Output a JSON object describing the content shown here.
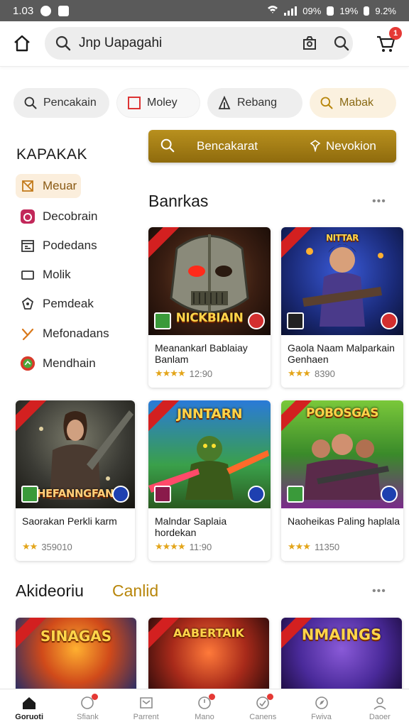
{
  "status_bar": {
    "time": "1.03",
    "right_a": "09%",
    "right_b": "19%",
    "right_c": "9.2%"
  },
  "search": {
    "placeholder": "Jnp Uapagahi"
  },
  "cart": {
    "badge": "1"
  },
  "chips": [
    {
      "label": "Pencakain",
      "icon": "search-icon"
    },
    {
      "label": "Moley",
      "icon": "square-icon"
    },
    {
      "label": "Rebang",
      "icon": "tent-icon"
    },
    {
      "label": "Mabak",
      "icon": "search-icon"
    }
  ],
  "sidebar": {
    "title": "KAPAKAK",
    "items": [
      {
        "label": "Meuar",
        "icon": "grid-x-icon"
      },
      {
        "label": "Decobrain",
        "icon": "game-icon"
      },
      {
        "label": "Podedans",
        "icon": "calendar-icon"
      },
      {
        "label": "Molik",
        "icon": "rect-icon"
      },
      {
        "label": "Pemdeak",
        "icon": "puzzle-icon"
      },
      {
        "label": "Mefonadans",
        "icon": "fork-icon"
      },
      {
        "label": "Mendhain",
        "icon": "circle-icon"
      }
    ]
  },
  "promo": {
    "left_label": "Bencakarat",
    "right_label": "Nevokion"
  },
  "section1": {
    "title": "Banrkas",
    "more": "•••"
  },
  "games": [
    {
      "art_title": "NICKBIAIN",
      "name": "Meanankarl Bablaiay Banlam",
      "rating": "12:90",
      "stars": "★★★★",
      "theme": "a"
    },
    {
      "art_title": "NITTAR",
      "name": "Gaola Naam Malparkain Genhaen",
      "rating": "8390",
      "stars": "★★★",
      "theme": "b"
    },
    {
      "art_title": "HEFANNGFAN",
      "name": "Saorakan Perkli karm",
      "rating": "359010",
      "stars": "★★",
      "theme": "c"
    },
    {
      "art_title": "JNNTARN",
      "name": "Malndar Saplaia hordekan",
      "rating": "11:90",
      "stars": "★★★★",
      "theme": "d"
    },
    {
      "art_title": "POBOSGAS",
      "name": "Naoheikas Paling haplala",
      "rating": "11350",
      "stars": "★★★",
      "theme": "e"
    }
  ],
  "section2": {
    "title": "Akideoriu",
    "accent": "Canlid",
    "more": "•••"
  },
  "bottom_games": [
    {
      "art_title": "SINAGAS"
    },
    {
      "art_title": "AABERTAIK"
    },
    {
      "art_title": "NMAINGS"
    }
  ],
  "bottom_nav": [
    {
      "label": "Goruoti",
      "icon": "home-icon",
      "active": true
    },
    {
      "label": "Sfiank",
      "icon": "chat-icon",
      "badge": true
    },
    {
      "label": "Parrent",
      "icon": "inbox-icon"
    },
    {
      "label": "Mano",
      "icon": "tag-icon",
      "badge": true
    },
    {
      "label": "Canens",
      "icon": "ticket-icon",
      "badge": true
    },
    {
      "label": "Fwiva",
      "icon": "compass-icon"
    },
    {
      "label": "Daoer",
      "icon": "profile-icon"
    }
  ]
}
